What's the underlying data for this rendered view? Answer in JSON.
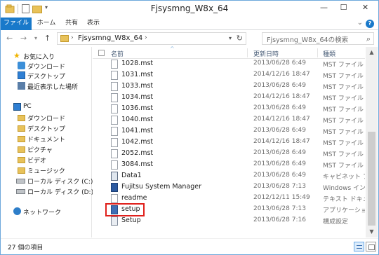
{
  "window": {
    "title": "Fjsysmng_W8x_64",
    "minimize_glyph": "—",
    "maximize_glyph": "☐",
    "close_glyph": "✕"
  },
  "quick_access": {
    "drop_glyph": "▾"
  },
  "ribbon": {
    "tabs": [
      {
        "label": "ファイル"
      },
      {
        "label": "ホーム"
      },
      {
        "label": "共有"
      },
      {
        "label": "表示"
      }
    ],
    "expand_glyph": "⌄",
    "help_glyph": "?"
  },
  "nav": {
    "back_glyph": "←",
    "forward_glyph": "→",
    "recent_glyph": "▾",
    "up_glyph": "↑"
  },
  "address": {
    "chevron1": "›",
    "path": "Fjsysmng_W8x_64",
    "chevron2": "›",
    "drop_glyph": "▾",
    "refresh_glyph": "↻"
  },
  "search": {
    "placeholder": "Fjsysmng_W8x_64の検索",
    "icon_glyph": "⌕"
  },
  "navpane": {
    "favorites": {
      "label": "お気に入り",
      "items": [
        {
          "label": "ダウンロード"
        },
        {
          "label": "デスクトップ"
        },
        {
          "label": "最近表示した場所"
        }
      ]
    },
    "pc": {
      "label": "PC",
      "items": [
        {
          "label": "ダウンロード"
        },
        {
          "label": "デスクトップ"
        },
        {
          "label": "ドキュメント"
        },
        {
          "label": "ピクチャ"
        },
        {
          "label": "ビデオ"
        },
        {
          "label": "ミュージック"
        },
        {
          "label": "ローカル ディスク (C:)"
        },
        {
          "label": "ローカル ディスク (D:)"
        }
      ]
    },
    "network": {
      "label": "ネットワーク"
    }
  },
  "columns": {
    "name": "名前",
    "date": "更新日時",
    "type": "種類",
    "sort_glyph": "^"
  },
  "files": [
    {
      "name": "1028.mst",
      "date": "2013/06/28 6:49",
      "type": "MST ファイル"
    },
    {
      "name": "1031.mst",
      "date": "2014/12/16 18:47",
      "type": "MST ファイル"
    },
    {
      "name": "1033.mst",
      "date": "2013/06/28 6:49",
      "type": "MST ファイル"
    },
    {
      "name": "1034.mst",
      "date": "2014/12/16 18:47",
      "type": "MST ファイル"
    },
    {
      "name": "1036.mst",
      "date": "2013/06/28 6:49",
      "type": "MST ファイル"
    },
    {
      "name": "1040.mst",
      "date": "2014/12/16 18:47",
      "type": "MST ファイル"
    },
    {
      "name": "1041.mst",
      "date": "2013/06/28 6:49",
      "type": "MST ファイル"
    },
    {
      "name": "1042.mst",
      "date": "2014/12/16 18:47",
      "type": "MST ファイル"
    },
    {
      "name": "2052.mst",
      "date": "2013/06/28 6:49",
      "type": "MST ファイル"
    },
    {
      "name": "3084.mst",
      "date": "2013/06/28 6:49",
      "type": "MST ファイル"
    },
    {
      "name": "Data1",
      "date": "2013/06/28 6:49",
      "type": "キャビネット ファイル"
    },
    {
      "name": "Fujitsu System Manager",
      "date": "2013/06/28 7:13",
      "type": "Windows インストーラー"
    },
    {
      "name": "readme",
      "date": "2012/12/11 15:49",
      "type": "テキスト ドキュメント"
    },
    {
      "name": "setup",
      "date": "2013/06/28 7:13",
      "type": "アプリケーション"
    },
    {
      "name": "Setup",
      "date": "2013/06/28 7:16",
      "type": "構成設定"
    }
  ],
  "scrollbar": {
    "up_glyph": "▲",
    "down_glyph": "▼"
  },
  "status": {
    "item_count": "27 個の項目"
  },
  "colors": {
    "accent": "#1979ca",
    "highlight_border": "#e0201b",
    "folder": "#e8c25a"
  }
}
